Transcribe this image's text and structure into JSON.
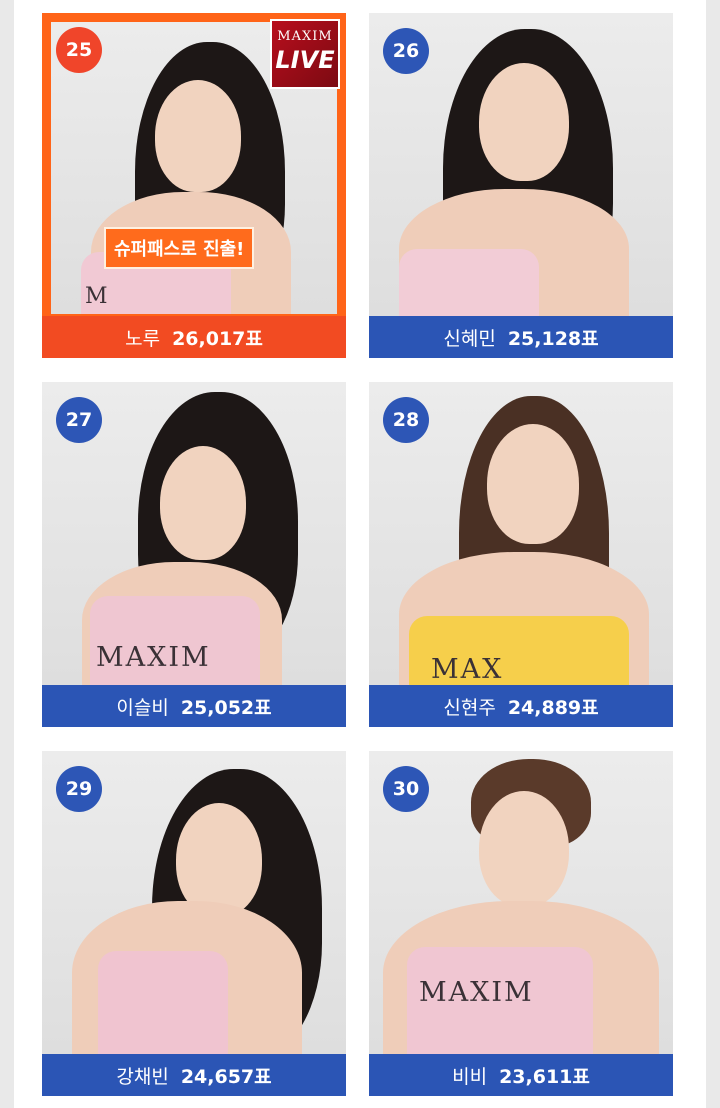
{
  "badge": {
    "brand": "MAXIM",
    "live": "LIVE"
  },
  "superpass_label": "슈퍼패스로 진출!",
  "contestants": [
    {
      "rank": "25",
      "name": "노루",
      "votes": "26,017표",
      "highlight": true,
      "top_color": "#f1c9d4",
      "logo": "M"
    },
    {
      "rank": "26",
      "name": "신혜민",
      "votes": "25,128표",
      "highlight": false,
      "top_color": "#f2ccd6",
      "logo": ""
    },
    {
      "rank": "27",
      "name": "이슬비",
      "votes": "25,052표",
      "highlight": false,
      "top_color": "#efc6d1",
      "logo": "MAXIM"
    },
    {
      "rank": "28",
      "name": "신현주",
      "votes": "24,889표",
      "highlight": false,
      "top_color": "#f6cf4b",
      "logo": "MAX"
    },
    {
      "rank": "29",
      "name": "강채빈",
      "votes": "24,657표",
      "highlight": false,
      "top_color": "#f0c4d0",
      "logo": ""
    },
    {
      "rank": "30",
      "name": "비비",
      "votes": "23,611표",
      "highlight": false,
      "top_color": "#f0c6d2",
      "logo": "MAXIM"
    }
  ],
  "colors": {
    "caption_blue": "#2b55b5",
    "highlight_orange": "#ff6418",
    "rank_blue": "#2d56b6",
    "rank_red": "#f0452a"
  }
}
